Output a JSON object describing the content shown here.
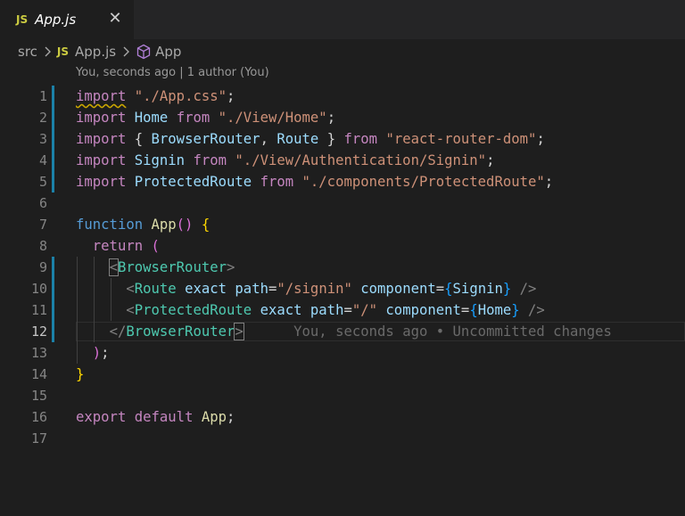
{
  "tab": {
    "badge": "JS",
    "title": "App.js",
    "close": "✕"
  },
  "breadcrumb": {
    "folder": "src",
    "file_badge": "JS",
    "file": "App.js",
    "symbol": "App"
  },
  "blame_header": "You, seconds ago | 1 author (You)",
  "inline_blame": "You, seconds ago • Uncommitted changes",
  "line_numbers": [
    "1",
    "2",
    "3",
    "4",
    "5",
    "6",
    "7",
    "8",
    "9",
    "10",
    "11",
    "12",
    "13",
    "14",
    "15",
    "16",
    "17"
  ],
  "code": {
    "l1": {
      "kw": "import",
      "str": "\"./App.css\"",
      "end": ";"
    },
    "l2": {
      "kw": "import",
      "id": "Home",
      "from": "from",
      "str": "\"./View/Home\"",
      "end": ";"
    },
    "l3": {
      "kw": "import",
      "open": "{",
      "id1": "BrowserRouter",
      "comma": ",",
      "id2": "Route",
      "close": "}",
      "from": "from",
      "str": "\"react-router-dom\"",
      "end": ";"
    },
    "l4": {
      "kw": "import",
      "id": "Signin",
      "from": "from",
      "str": "\"./View/Authentication/Signin\"",
      "end": ";"
    },
    "l5": {
      "kw": "import",
      "id": "ProtectedRoute",
      "from": "from",
      "str": "\"./components/ProtectedRoute\"",
      "end": ";"
    },
    "l7": {
      "kw": "function",
      "name": "App",
      "parens": "()",
      "brace": "{"
    },
    "l8": {
      "kw": "return",
      "paren": "("
    },
    "l9": {
      "lt": "<",
      "tag": "BrowserRouter",
      "gt": ">"
    },
    "l10": {
      "lt": "<",
      "tag": "Route",
      "a1": "exact",
      "a2": "path",
      "eq": "=",
      "v2": "\"/signin\"",
      "a3": "component",
      "eq2": "=",
      "ob": "{",
      "v3": "Signin",
      "cb": "}",
      "end": "/>"
    },
    "l11": {
      "lt": "<",
      "tag": "ProtectedRoute",
      "a1": "exact",
      "a2": "path",
      "eq": "=",
      "v2": "\"/\"",
      "a3": "component",
      "eq2": "=",
      "ob": "{",
      "v3": "Home",
      "cb": "}",
      "end": "/>"
    },
    "l12": {
      "lt": "</",
      "tag": "BrowserRouter",
      "gt": ">"
    },
    "l13": {
      "paren": ")",
      "end": ";"
    },
    "l14": {
      "brace": "}"
    },
    "l16": {
      "kw1": "export",
      "kw2": "default",
      "id": "App",
      "end": ";"
    }
  },
  "colors": {
    "background": "#1e1e1e",
    "keyword": "#569cd6",
    "control": "#c586c0",
    "string": "#ce9178",
    "variable": "#9cdcfe",
    "tag": "#4ec9b0",
    "function": "#dcdcaa",
    "git_gutter": "#1b81a8"
  }
}
